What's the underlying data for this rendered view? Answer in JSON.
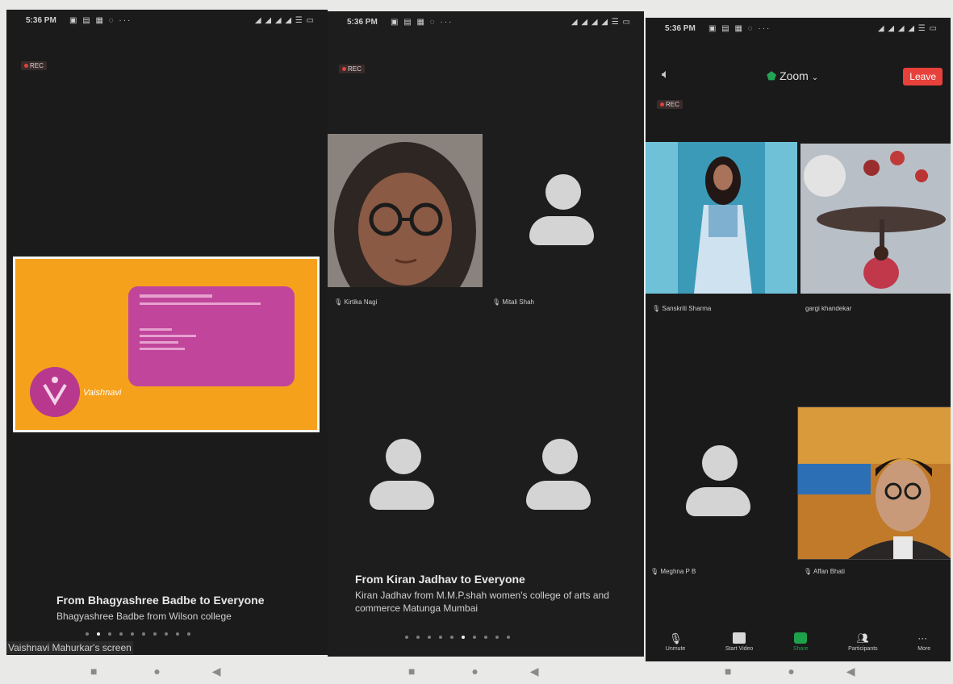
{
  "status": {
    "time": "5:36 PM"
  },
  "rec_label": "REC",
  "phone1": {
    "screen_share_label": "Vaishnavi Mahurkar's screen",
    "chat": {
      "title": "From Bhagyashree Badbe to Everyone",
      "message": "Bhagyashree Badbe from Wilson college"
    },
    "slide": {
      "logo_text": "Vaishnavi"
    }
  },
  "phone2": {
    "participants": [
      {
        "name": "Kirtika Nagi"
      },
      {
        "name": "Mitali Shah"
      }
    ],
    "chat": {
      "title": "From Kiran Jadhav to Everyone",
      "message": "Kiran Jadhav from M.M.P.shah women's college of arts and commerce Matunga Mumbai"
    }
  },
  "phone3": {
    "app_name": "Zoom",
    "leave_label": "Leave",
    "participants": [
      {
        "name": "Sanskriti Sharma"
      },
      {
        "name": "gargi khandekar"
      },
      {
        "name": "Meghna P B"
      },
      {
        "name": "Affan Bhati"
      }
    ],
    "toolbar": [
      {
        "label": "Unmute",
        "icon": "mic-muted-icon"
      },
      {
        "label": "Start Video",
        "icon": "video-off-icon"
      },
      {
        "label": "Share",
        "icon": "share-icon"
      },
      {
        "label": "Participants",
        "icon": "participants-icon"
      },
      {
        "label": "More",
        "icon": "more-icon"
      }
    ]
  },
  "colors": {
    "leave": "#e8403a",
    "share": "#1fa04a",
    "slide_bg": "#f5a11c",
    "slide_card": "#c0459b"
  }
}
